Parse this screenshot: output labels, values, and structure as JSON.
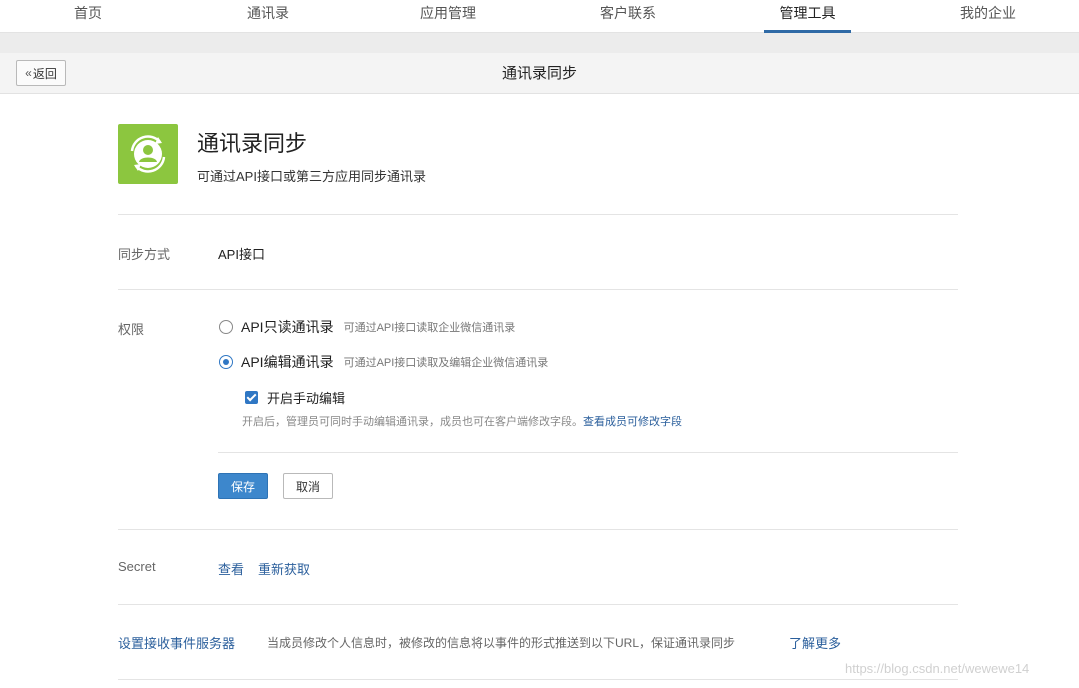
{
  "nav": {
    "tabs": [
      {
        "label": "首页"
      },
      {
        "label": "通讯录"
      },
      {
        "label": "应用管理"
      },
      {
        "label": "客户联系"
      },
      {
        "label": "管理工具"
      },
      {
        "label": "我的企业"
      }
    ],
    "active_tab": "管理工具"
  },
  "subheader": {
    "back_label": "返回",
    "back_icon": "double-chevron-left-icon",
    "title": "通讯录同步"
  },
  "app": {
    "icon": "contact-sync-icon",
    "icon_color": "#8cc63f",
    "title": "通讯录同步",
    "description": "可通过API接口或第三方应用同步通讯录"
  },
  "sync_method": {
    "label": "同步方式",
    "value": "API接口"
  },
  "permission": {
    "label": "权限",
    "options": [
      {
        "label": "API只读通讯录",
        "hint": "可通过API接口读取企业微信通讯录",
        "checked": false
      },
      {
        "label": "API编辑通讯录",
        "hint": "可通过API接口读取及编辑企业微信通讯录",
        "checked": true
      }
    ],
    "manual_edit": {
      "label": "开启手动编辑",
      "checked": true,
      "hint": "开启后，管理员可同时手动编辑通讯录，成员也可在客户端修改字段。",
      "hint_link": "查看成员可修改字段"
    },
    "save_label": "保存",
    "cancel_label": "取消"
  },
  "secret": {
    "label": "Secret",
    "view_label": "查看",
    "refresh_label": "重新获取"
  },
  "event_server": {
    "label": "设置接收事件服务器",
    "description": "当成员修改个人信息时，被修改的信息将以事件的形式推送到以下URL，保证通讯录同步",
    "learn_more": "了解更多"
  },
  "watermark": "https://blog.csdn.net/wewewe14",
  "colors": {
    "accent": "#2f77c4",
    "link": "#2b5f9c",
    "primary_button": "#3d87cc"
  }
}
